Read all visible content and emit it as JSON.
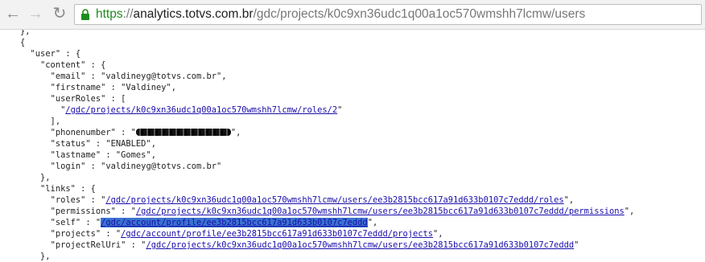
{
  "browser": {
    "url_scheme": "https",
    "url_separator": "://",
    "url_host": "analytics.totvs.com.br",
    "url_path": "/gdc/projects/k0c9xn36udc1q00a1oc570wmshh7lcmw/users"
  },
  "json": {
    "line_close_outer": "},",
    "line_open_obj": "{",
    "key_user": "\"user\"",
    "key_content": "\"content\"",
    "key_email": "\"email\"",
    "val_email": "\"valdineyg@totvs.com.br\"",
    "key_firstname": "\"firstname\"",
    "val_firstname": "\"Valdiney\"",
    "key_userRoles": "\"userRoles\"",
    "link_roles2": "/gdc/projects/k0c9xn36udc1q00a1oc570wmshh7lcmw/roles/2",
    "key_phonenumber": "\"phonenumber\"",
    "key_status": "\"status\"",
    "val_status": "\"ENABLED\"",
    "key_lastname": "\"lastname\"",
    "val_lastname": "\"Gomes\"",
    "key_login": "\"login\"",
    "val_login": "\"valdineyg@totvs.com.br\"",
    "key_links": "\"links\"",
    "key_roles": "\"roles\"",
    "link_roles": "/gdc/projects/k0c9xn36udc1q00a1oc570wmshh7lcmw/users/ee3b2815bcc617a91d633b0107c7eddd/roles",
    "key_permissions": "\"permissions\"",
    "link_permissions": "/gdc/projects/k0c9xn36udc1q00a1oc570wmshh7lcmw/users/ee3b2815bcc617a91d633b0107c7eddd/permissions",
    "key_self": "\"self\"",
    "link_self": "/gdc/account/profile/ee3b2815bcc617a91d633b0107c7eddd",
    "key_projects": "\"projects\"",
    "link_projects": "/gdc/account/profile/ee3b2815bcc617a91d633b0107c7eddd/projects",
    "key_projectRelUri": "\"projectRelUri\"",
    "link_projectRelUri": "/gdc/projects/k0c9xn36udc1q00a1oc570wmshh7lcmw/users/ee3b2815bcc617a91d633b0107c7eddd"
  }
}
